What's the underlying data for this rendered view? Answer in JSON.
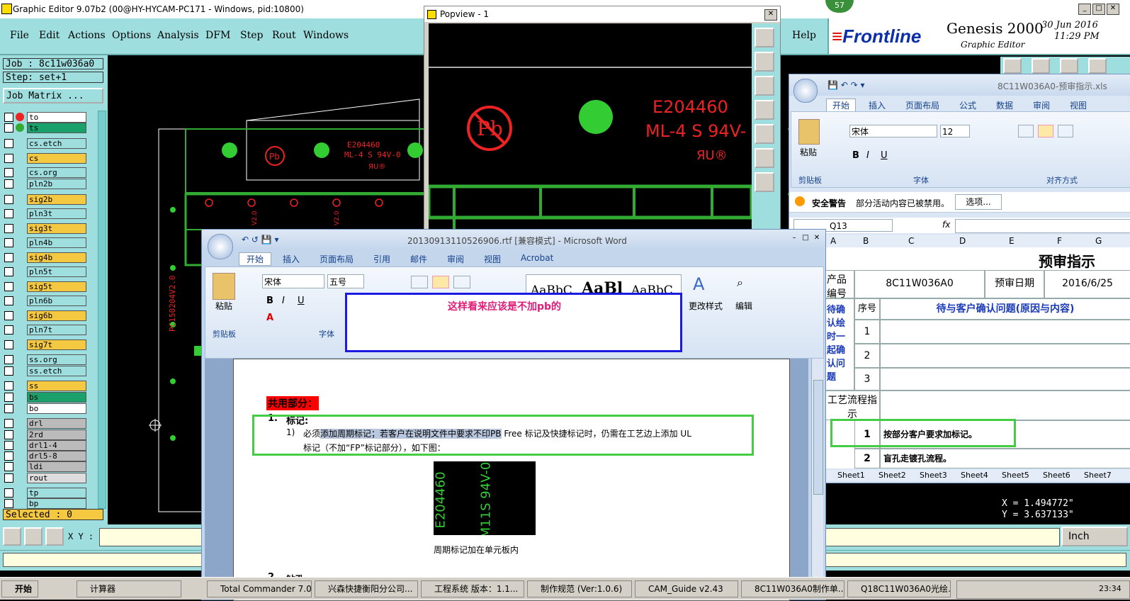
{
  "genesis": {
    "title": "Graphic Editor 9.07b2 (00@HY-HYCAM-PC171 - Windows, pid:10800)",
    "menu": [
      "File",
      "Edit",
      "Actions",
      "Options",
      "Analysis",
      "DFM",
      "Step",
      "Rout",
      "Windows"
    ],
    "help": "Help",
    "badge": "57",
    "brand": "Frontline",
    "product": "Genesis 2000",
    "product_sub": "Graphic Editor",
    "date": "30 Jun 2016",
    "time": "11:29 PM",
    "job": "Job : 8c11w036a0",
    "step": "Step: set+1",
    "job_matrix": "Job Matrix ...",
    "layers": [
      "to",
      "ts",
      "cs.etch",
      "cs",
      "cs.org",
      "pln2b",
      "sig2b",
      "pln3t",
      "sig3t",
      "pln4b",
      "sig4b",
      "pln5t",
      "sig5t",
      "pln6b",
      "sig6b",
      "pln7t",
      "sig7t",
      "ss.org",
      "ss.etch",
      "ss",
      "bs",
      "bo",
      "drl",
      "2rd",
      "drl1-4",
      "drl5-8",
      "ldi",
      "rout",
      "tp",
      "bp"
    ],
    "selected": "Selected : 0",
    "xy_label": "X Y :",
    "coord_x": "X = 1.494772\"",
    "coord_y": "Y = 3.637133\"",
    "units": "Inch",
    "canvas_text": {
      "ul": "E204460",
      "ml": "ML-4 S 94V-0",
      "pn": "PC150204V2.0",
      "small_1": "V2.0",
      "small_2": "V2.0"
    }
  },
  "popview": {
    "title": "Popview - 1",
    "ul_num": "E204460",
    "ml": "ML-4 S 94V-",
    "pb": "Pb"
  },
  "excel": {
    "title": "8C11W036A0-预审指示.xls",
    "tabs": [
      "开始",
      "插入",
      "页面布局",
      "公式",
      "数据",
      "审阅",
      "视图"
    ],
    "font_name": "宋体",
    "font_size": "12",
    "group_clipboard": "剪贴板",
    "group_font": "字体",
    "group_align": "对齐方式",
    "paste": "粘贴",
    "security_title": "安全警告",
    "security_msg": "部分活动内容已被禁用。",
    "options_btn": "选项...",
    "name_box": "Q13",
    "fx": "fx",
    "cols": [
      "A",
      "B",
      "C",
      "D",
      "E",
      "F",
      "G"
    ],
    "sheet_title": "预审指示",
    "product_label": "产品编号",
    "product_value": "8C11W036A0",
    "date_label": "预审日期",
    "date_value": "2016/6/25",
    "seq_label": "序号",
    "issue_header": "待与客户确认问题(原因与内容)",
    "confirm_label": "待确认绘时一起确认问题",
    "rows": [
      "1",
      "2",
      "3"
    ],
    "process_label": "工艺流程指示",
    "proc_rows": [
      {
        "n": "1",
        "text": "按部分客户要求加标记。"
      },
      {
        "n": "2",
        "text": "盲孔走镀孔流程。"
      }
    ],
    "sheets": [
      "Sheet1",
      "Sheet2",
      "Sheet3",
      "Sheet4",
      "Sheet5",
      "Sheet6",
      "Sheet7"
    ]
  },
  "word": {
    "title": "20130913110526906.rtf [兼容模式] - Microsoft Word",
    "tabs": [
      "开始",
      "插入",
      "页面布局",
      "引用",
      "邮件",
      "审阅",
      "视图",
      "Acrobat"
    ],
    "font_name": "宋体",
    "font_size": "五号",
    "paste": "粘贴",
    "group_clipboard": "剪贴板",
    "group_font": "字体",
    "style1": "AaBbC",
    "style2": "AaBl",
    "style3": "AaBbC",
    "change_styles": "更改样式",
    "edit": "编辑",
    "heading": "共用部分：",
    "item_num": "1.",
    "item_title": "标记:",
    "sub_num": "1)",
    "line1_a": "必须",
    "line1_hl": "添加周期标记；若客户在说明文件中要求不印PB",
    "line1_b": " Free 标记及快捷标记时，仍需在工艺边上添加 UL",
    "line2": "标记（不加“FP”标记部分），如下图：",
    "img_ul": "E204460",
    "img_ml": "M11S 94V-0",
    "caption": "周期标记加在单元板内",
    "next_num": "2.",
    "next_title": "钻孔"
  },
  "callout": "这样看来应该是不加pb的",
  "taskbar": {
    "start": "开始",
    "items": [
      "计算器",
      "Total Commander 7.0 ...",
      "兴森快捷衡阳分公司...",
      "工程系统  版本：1.1...",
      "制作规范 (Ver:1.0.6)",
      "CAM_Guide v2.43",
      "8C11W036A0制作单...",
      "Q18C11W036A0光绘..."
    ],
    "clock": "23:34"
  }
}
